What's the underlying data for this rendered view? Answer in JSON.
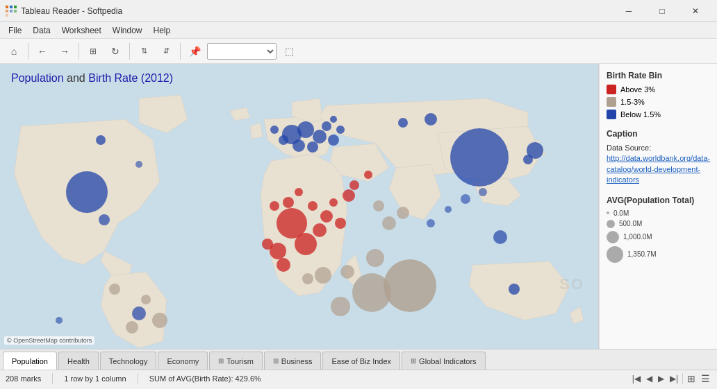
{
  "titleBar": {
    "appName": "Tableau Reader - Softpedia",
    "minBtn": "─",
    "maxBtn": "□",
    "closeBtn": "✕"
  },
  "menuBar": {
    "items": [
      "File",
      "Data",
      "Worksheet",
      "Window",
      "Help"
    ]
  },
  "toolbar": {
    "backBtn": "←",
    "forwardBtn": "→",
    "dropdownPlaceholder": "",
    "presentBtn": "⬚"
  },
  "chart": {
    "title": "Population",
    "andText": " and ",
    "titlePart2": "Birth Rate (2012)",
    "osmCredit": "© OpenStreetMap contributors"
  },
  "legend": {
    "birthRateTitle": "Birth Rate Bin",
    "items": [
      {
        "label": "Above 3%",
        "color": "red"
      },
      {
        "label": "1.5-3%",
        "color": "gray"
      },
      {
        "label": "Below 1.5%",
        "color": "blue"
      }
    ],
    "captionTitle": "Caption",
    "captionPrefix": "Data Source: ",
    "captionLinkText": "http://data.worldbank.org/data-catalog/world-development-indicators",
    "avgTitle": "AVG(Population Total)",
    "avgItems": [
      {
        "size": 4,
        "label": "0.0M"
      },
      {
        "size": 10,
        "label": "500.0M"
      },
      {
        "size": 16,
        "label": "1,000.0M"
      },
      {
        "size": 22,
        "label": "1,350.7M"
      }
    ]
  },
  "tabs": [
    {
      "id": "population",
      "label": "Population",
      "icon": "",
      "active": true
    },
    {
      "id": "health",
      "label": "Health",
      "icon": "",
      "active": false
    },
    {
      "id": "technology",
      "label": "Technology",
      "icon": "",
      "active": false
    },
    {
      "id": "economy",
      "label": "Economy",
      "icon": "",
      "active": false
    },
    {
      "id": "tourism",
      "label": "Tourism",
      "icon": "⊞",
      "active": false
    },
    {
      "id": "business",
      "label": "Business",
      "icon": "⊞",
      "active": false
    },
    {
      "id": "ease-of-biz",
      "label": "Ease of Biz Index",
      "icon": "",
      "active": false
    },
    {
      "id": "global",
      "label": "Global Indicators",
      "icon": "⊞",
      "active": false
    }
  ],
  "statusBar": {
    "marks": "208 marks",
    "rows": "1 row by 1 column",
    "sum": "SUM of AVG(Birth Rate): 429.6%"
  },
  "watermark": "SO"
}
